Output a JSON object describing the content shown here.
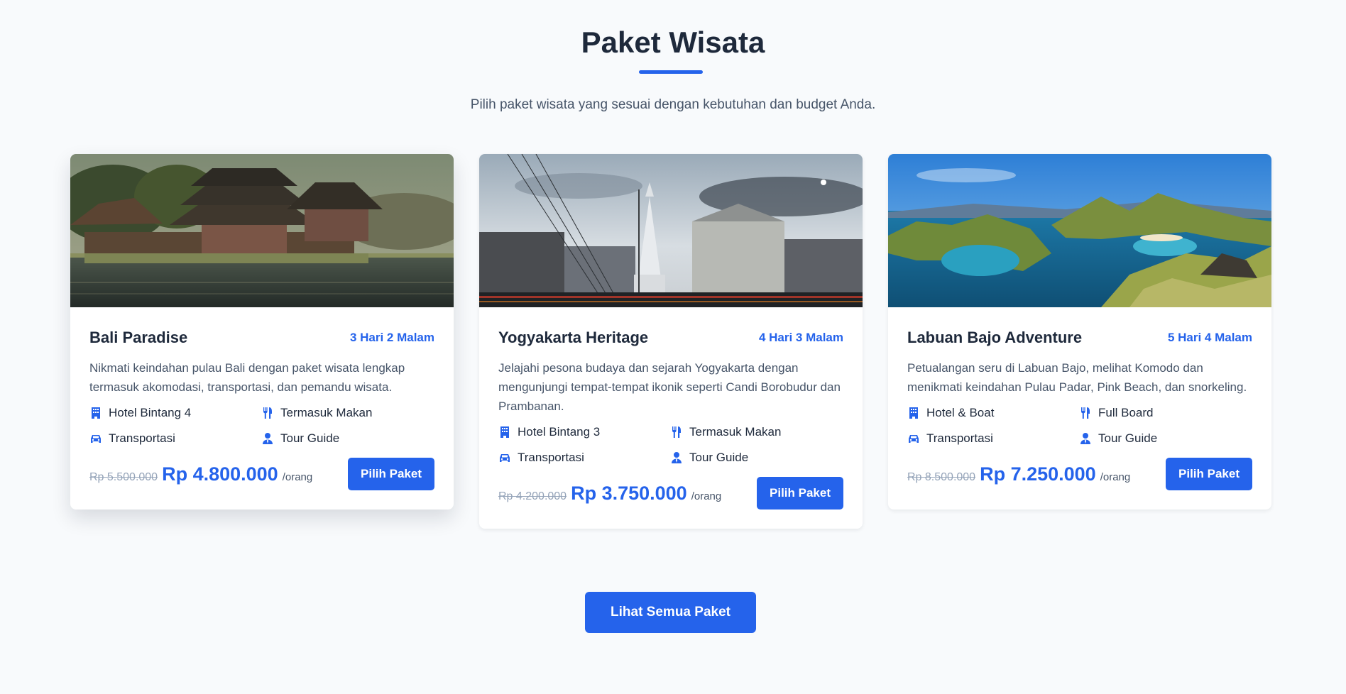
{
  "section": {
    "title": "Paket Wisata",
    "subtitle": "Pilih paket wisata yang sesuai dengan kebutuhan dan budget Anda."
  },
  "colors": {
    "accent": "#2563eb",
    "heading": "#1e293b",
    "muted": "#475569",
    "strike": "#94a3b8"
  },
  "packages": [
    {
      "name": "Bali Paradise",
      "duration": "3 Hari 2 Malam",
      "description": "Nikmati keindahan pulau Bali dengan paket wisata lengkap termasuk akomodasi, transportasi, dan pemandu wisata.",
      "features": [
        {
          "icon": "building-icon",
          "label": "Hotel Bintang 4"
        },
        {
          "icon": "utensils-icon",
          "label": "Termasuk Makan"
        },
        {
          "icon": "car-icon",
          "label": "Transportasi"
        },
        {
          "icon": "user-tie-icon",
          "label": "Tour Guide"
        }
      ],
      "price_old": "Rp 5.500.000",
      "price_new": "Rp 4.800.000",
      "price_unit": "/orang",
      "button": "Pilih Paket"
    },
    {
      "name": "Yogyakarta Heritage",
      "duration": "4 Hari 3 Malam",
      "description": "Jelajahi pesona budaya dan sejarah Yogyakarta dengan mengunjungi tempat-tempat ikonik seperti Candi Borobudur dan Prambanan.",
      "features": [
        {
          "icon": "building-icon",
          "label": "Hotel Bintang 3"
        },
        {
          "icon": "utensils-icon",
          "label": "Termasuk Makan"
        },
        {
          "icon": "car-icon",
          "label": "Transportasi"
        },
        {
          "icon": "user-tie-icon",
          "label": "Tour Guide"
        }
      ],
      "price_old": "Rp 4.200.000",
      "price_new": "Rp 3.750.000",
      "price_unit": "/orang",
      "button": "Pilih Paket"
    },
    {
      "name": "Labuan Bajo Adventure",
      "duration": "5 Hari 4 Malam",
      "description": "Petualangan seru di Labuan Bajo, melihat Komodo dan menikmati keindahan Pulau Padar, Pink Beach, dan snorkeling.",
      "features": [
        {
          "icon": "building-icon",
          "label": "Hotel & Boat"
        },
        {
          "icon": "utensils-icon",
          "label": "Full Board"
        },
        {
          "icon": "car-icon",
          "label": "Transportasi"
        },
        {
          "icon": "user-tie-icon",
          "label": "Tour Guide"
        }
      ],
      "price_old": "Rp 8.500.000",
      "price_new": "Rp 7.250.000",
      "price_unit": "/orang",
      "button": "Pilih Paket"
    }
  ],
  "cta": {
    "label": "Lihat Semua Paket"
  }
}
